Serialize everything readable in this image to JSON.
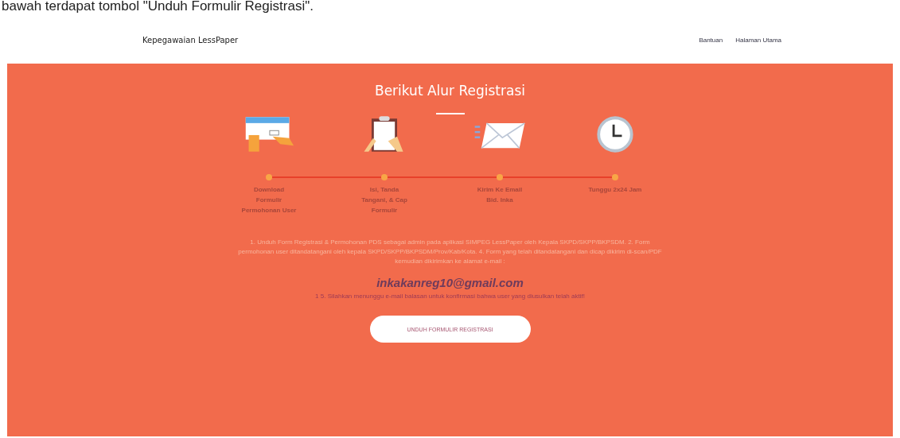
{
  "document_text": "bawah terdapat tombol \"Unduh Formulir Registrasi\".",
  "header": {
    "brand": "Kepegawaian LessPaper",
    "links": [
      "Bantuan",
      "Halaman Utama"
    ]
  },
  "section": {
    "title": "Berikut Alur Registrasi",
    "steps": [
      {
        "label": "Download Formulir Permohonan User"
      },
      {
        "label": "Isi, Tanda Tangani, & Cap Formulir"
      },
      {
        "label": "Kirim Ke Email Bid. Inka"
      },
      {
        "label": "Tunggu 2x24 Jam"
      }
    ],
    "instructions": "1. Unduh Form Registrasi & Permohonan PDS sebagai admin pada aplikasi SIMPEG LessPaper oleh Kepala SKPD/SKPP/BKPSDM. 2. Form permohonan user ditandatangani oleh kepala SKPD/SKPP/BKPSDM/Prov/Kab/Kota. 4. Form yang telah ditandatangani dan dicap dikirim di-scan/PDF kemudian dikirimkan ke alamat e-mail :",
    "email": "inkakanreg10@gmail.com",
    "notice": "1 5. Silahkan menunggu e-mail balasan untuk konfirmasi bahwa user yang diusulkan telah aktif!",
    "button": "UNDUH FORMULIR REGISTRASI"
  }
}
